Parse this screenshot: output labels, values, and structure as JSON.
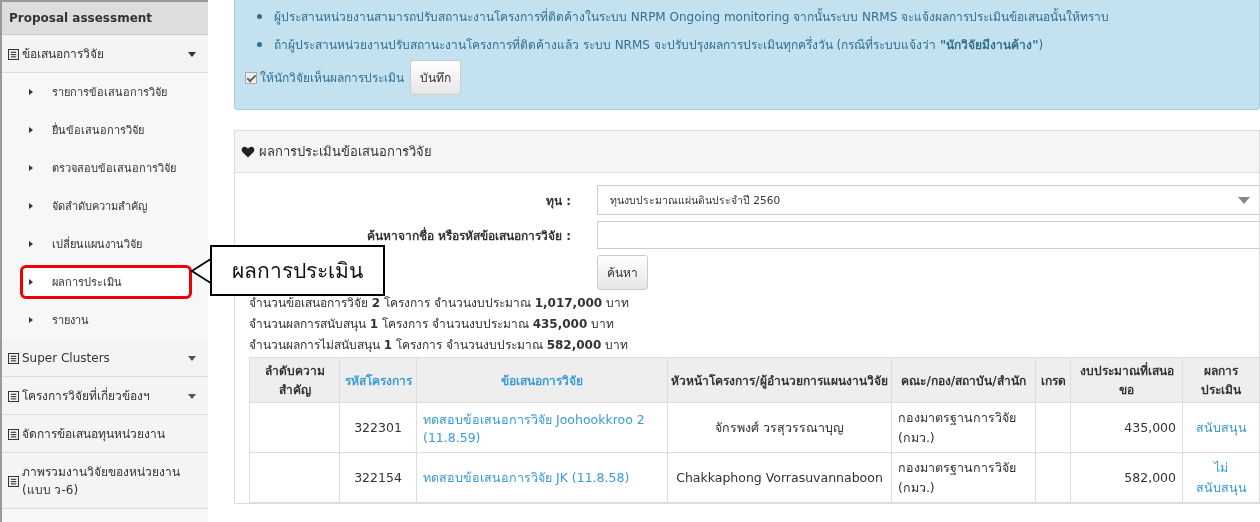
{
  "sidebar": {
    "title": "Proposal assessment",
    "groups": [
      {
        "label": "ข้อเสนอการวิจัย",
        "expanded": true,
        "children": [
          {
            "label": "รายการข้อเสนอการวิจัย",
            "selected": false
          },
          {
            "label": "ยื่นข้อเสนอการวิจัย",
            "selected": false
          },
          {
            "label": "ตรวจสอบข้อเสนอการวิจัย",
            "selected": false
          },
          {
            "label": "จัดลำดับความสำคัญ",
            "selected": false
          },
          {
            "label": "เปลี่ยนแผนงานวิจัย",
            "selected": false
          },
          {
            "label": "ผลการประเมิน",
            "selected": true
          },
          {
            "label": "รายงาน",
            "selected": false
          }
        ]
      },
      {
        "label": "Super Clusters",
        "expanded": false
      },
      {
        "label": "โครงการวิจัยที่เกี่ยวข้องฯ",
        "expanded": false
      },
      {
        "label": "จัดการข้อเสนอทุนหน่วยงาน"
      },
      {
        "label": "ภาพรวมงานวิจัยของหน่วยงาน (แบบ ว-6)"
      }
    ]
  },
  "notice": {
    "bullets": [
      "ผู้ประสานหน่วยงานสามารถปรับสถานะงานโครงการที่ติดค้างในระบบ NRPM Ongoing monitoring จากนั้นระบบ NRMS จะแจ้งผลการประเมินข้อเสนอนั้นให้ทราบ",
      "ถ้าผู้ประสานหน่วยงานปรับสถานะงานโครงการที่ติดค้างแล้ว ระบบ NRMS จะปรับปรุงผลการประเมินทุกครึ่งวัน (กรณีที่ระบบแจ้งว่า **\"นักวิจัยมีงานค้าง\"**)"
    ],
    "checkbox": {
      "label": "ให้นักวิจัยเห็นผลการประเมิน",
      "checked": true
    },
    "save_button": "บันทึก"
  },
  "panel": {
    "title": "ผลการประเมินข้อเสนอการวิจัย",
    "fund": {
      "label": "ทุน :",
      "value": "ทุนงบประมาณแผ่นดินประจำปี 2560"
    },
    "search": {
      "label": "ค้นหาจากชื่อ หรือรหัสข้อเสนอการวิจัย :"
    },
    "search_button": "ค้นหา",
    "summary": [
      "จำนวนข้อเสนอการวิจัย **2** โครงการ จำนวนงบประมาณ **1,017,000** บาท",
      "จำนวนผลการสนับสนุน **1** โครงการ จำนวนงบประมาณ **435,000** บาท",
      "จำนวนผลการไม่สนับสนุน **1** โครงการ จำนวนงบประมาณ **582,000** บาท"
    ],
    "table": {
      "columns": [
        {
          "label": "ลำดับความสำคัญ",
          "sortable": false
        },
        {
          "label": "รหัสโครงการ",
          "sortable": true
        },
        {
          "label": "ข้อเสนอการวิจัย",
          "sortable": true
        },
        {
          "label": "หัวหน้าโครงการ/ผู้อำนวยการแผนงานวิจัย",
          "sortable": false
        },
        {
          "label": "คณะ/กอง/สถาบัน/สำนัก",
          "sortable": false
        },
        {
          "label": "เกรด",
          "sortable": false
        },
        {
          "label": "งบประมาณที่เสนอขอ",
          "sortable": false
        },
        {
          "label": "ผลการประเมิน",
          "sortable": false
        }
      ],
      "rows": [
        [
          "",
          "322301",
          "ทดสอบข้อเสนอการวิจัย Joohookkroo 2 (11.8.59)",
          "จักรพงศ์ วรสุวรรณาบุญ",
          "กองมาตรฐานการวิจัย (กมว.)",
          "",
          "435,000",
          "สนับสนุน"
        ],
        [
          "",
          "322154",
          "ทดสอบข้อเสนอการวิจัย JK (11.8.58)",
          "Chakkaphong Vorrasuvannaboon",
          "กองมาตรฐานการวิจัย (กมว.)",
          "",
          "582,000",
          "ไม่สนับสนุน"
        ]
      ]
    }
  },
  "callout": "ผลการประเมิน"
}
